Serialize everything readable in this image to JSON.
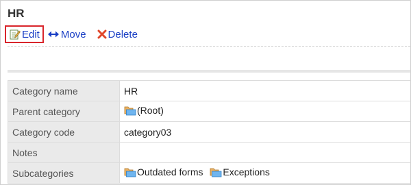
{
  "page": {
    "title": "HR"
  },
  "toolbar": {
    "edit_label": "Edit",
    "move_label": "Move",
    "delete_label": "Delete"
  },
  "details": {
    "rows": [
      {
        "label": "Category name",
        "value": "HR"
      },
      {
        "label": "Parent category",
        "value": "(Root)"
      },
      {
        "label": "Category code",
        "value": "category03"
      },
      {
        "label": "Notes",
        "value": ""
      },
      {
        "label": "Subcategories",
        "value": ""
      }
    ],
    "subcategories": [
      "Outdated forms",
      "Exceptions"
    ]
  },
  "icons": {
    "edit": "edit-pencil-icon",
    "move": "move-arrows-icon",
    "delete": "delete-x-icon",
    "folder": "folder-icon"
  },
  "colors": {
    "link": "#1a3fc5",
    "highlight_border": "#d9252b",
    "delete_icon": "#e0462a",
    "header_cell_bg": "#eaeaea"
  }
}
